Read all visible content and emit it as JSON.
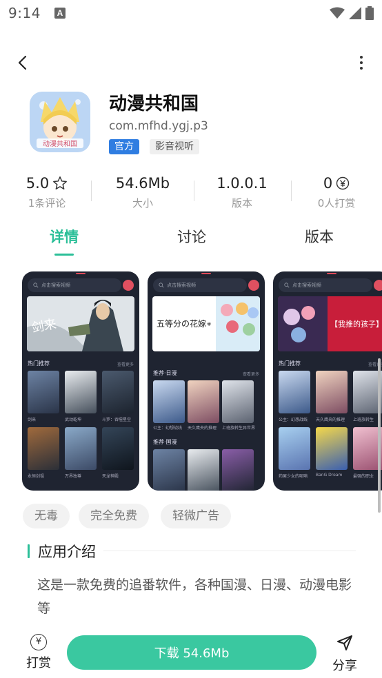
{
  "status_bar": {
    "time": "9:14",
    "notification_icon": "A"
  },
  "app": {
    "name": "动漫共和国",
    "package": "com.mfhd.ygj.p3",
    "badge_official": "官方",
    "category": "影音视听",
    "icon_text": "动漫共和国"
  },
  "stats": {
    "rating": {
      "value": "5.0",
      "label": "1条评论"
    },
    "size": {
      "value": "54.6Mb",
      "label": "大小"
    },
    "version": {
      "value": "1.0.0.1",
      "label": "版本"
    },
    "tips": {
      "value": "0",
      "label": "0人打赏"
    }
  },
  "tabs": [
    {
      "label": "详情",
      "active": true
    },
    {
      "label": "讨论",
      "active": false
    },
    {
      "label": "版本",
      "active": false
    }
  ],
  "screenshots": [
    {
      "search": "点击搜索视频",
      "banner_text": "剑来",
      "section1": "热门推荐",
      "more": "查看更多",
      "captions": [
        "剑来",
        "武动乾坤",
        "斗罗：吞噬星空",
        "永恒剑祖",
        "万界独尊",
        "天龙神殿"
      ]
    },
    {
      "search": "点击搜索视频",
      "banner_text": "五等分の花嫁∗",
      "section1": "推荐·日漫",
      "section2": "推荐·国漫",
      "more": "查看更多",
      "captions": [
        "公主：幻想战线",
        "天久鹰央的推理",
        "上班族转生异世界"
      ]
    },
    {
      "search": "点击搜索视频",
      "banner_text": "【我推的孩子】",
      "section1": "热门推荐",
      "more": "查看更多",
      "captions": [
        "公主：幻想战线",
        "天久鹰央的推理",
        "上班族转生",
        "药屋少女的呢喃",
        "BanG Dream",
        "最强的职业"
      ]
    }
  ],
  "chips": [
    "无毒",
    "完全免费",
    "轻微广告"
  ],
  "intro": {
    "title": "应用介绍",
    "text": "这是一款免费的追番软件，各种国漫、日漫、动漫电影等"
  },
  "bottom": {
    "tip_label": "打赏",
    "download_label": "下载 54.6Mb",
    "share_label": "分享"
  },
  "colors": {
    "accent": "#2bbf98",
    "button": "#3ac8a0",
    "official": "#2f7de1"
  }
}
